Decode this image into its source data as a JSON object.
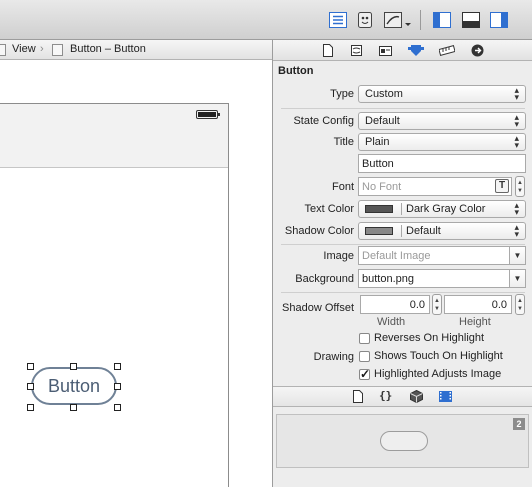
{
  "jumpbar": {
    "items": [
      "View",
      "Button – Button"
    ],
    "separator": "›"
  },
  "canvas": {
    "button_title": "Button"
  },
  "inspector": {
    "section_title": "Button",
    "type": {
      "label": "Type",
      "value": "Custom"
    },
    "state_config": {
      "label": "State Config",
      "value": "Default"
    },
    "title": {
      "label": "Title",
      "value": "Plain",
      "text": "Button"
    },
    "font": {
      "label": "Font",
      "placeholder": "No Font"
    },
    "text_color": {
      "label": "Text Color",
      "value": "Dark Gray Color"
    },
    "shadow_color": {
      "label": "Shadow Color",
      "value": "Default"
    },
    "image": {
      "label": "Image",
      "placeholder": "Default Image"
    },
    "background": {
      "label": "Background",
      "value": "button.png"
    },
    "shadow_offset": {
      "label": "Shadow Offset",
      "width": "0.0",
      "height": "0.0",
      "width_label": "Width",
      "height_label": "Height"
    },
    "drawing_label": "Drawing",
    "checkboxes": [
      {
        "label": "Reverses On Highlight",
        "checked": false
      },
      {
        "label": "Shows Touch On Highlight",
        "checked": false
      },
      {
        "label": "Highlighted Adjusts Image",
        "checked": true
      }
    ]
  },
  "library": {
    "badge": "2"
  },
  "colors": {
    "accent_blue": "#2f6fd0",
    "toolbar_gray": "#d6d6d6",
    "button_border": "#6f8196"
  },
  "icons": {
    "toolbar": [
      "standard-editor-icon",
      "assistant-editor-icon",
      "version-editor-icon",
      "navigator-toggle-icon",
      "debug-area-toggle-icon",
      "utilities-toggle-icon"
    ],
    "inspector_tabs": [
      "file-inspector-icon",
      "quick-help-icon",
      "identity-inspector-icon",
      "attributes-inspector-icon",
      "size-inspector-icon",
      "connections-inspector-icon"
    ],
    "library_tabs": [
      "file-template-icon",
      "code-snippet-icon",
      "object-library-icon",
      "media-library-icon"
    ]
  }
}
